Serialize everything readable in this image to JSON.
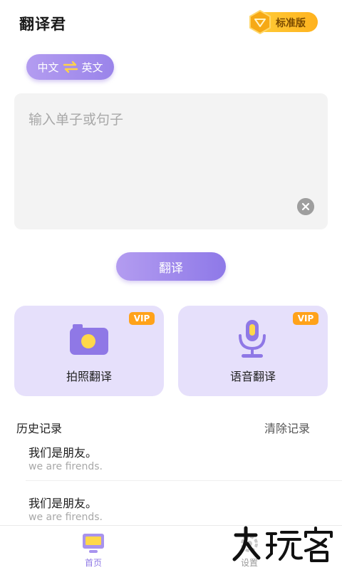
{
  "app": {
    "title": "翻译君"
  },
  "edition": {
    "label": "标准版",
    "icon": "diamond-icon",
    "color": "#ffb21e"
  },
  "language": {
    "source": "中文",
    "target": "英文",
    "swap_icon": "swap-arrows-icon",
    "accent": "#9a84ea"
  },
  "input": {
    "placeholder": "输入单子或句子",
    "value": ""
  },
  "translate_button": {
    "label": "翻译"
  },
  "features": [
    {
      "label": "拍照翻译",
      "badge": "VIP",
      "icon": "camera-icon"
    },
    {
      "label": "语音翻译",
      "badge": "VIP",
      "icon": "microphone-icon"
    }
  ],
  "history": {
    "title": "历史记录",
    "clear_label": "清除记录",
    "items": [
      {
        "source": "我们是朋友。",
        "translation": "we are firends."
      },
      {
        "source": "我们是朋友。",
        "translation": "we are firends."
      }
    ]
  },
  "tabbar": {
    "tabs": [
      {
        "label": "首页",
        "icon": "monitor-icon",
        "active": true
      },
      {
        "label": "设置",
        "icon": "gear-icon",
        "active": false
      }
    ]
  },
  "watermark": {
    "text": "大玩客"
  }
}
